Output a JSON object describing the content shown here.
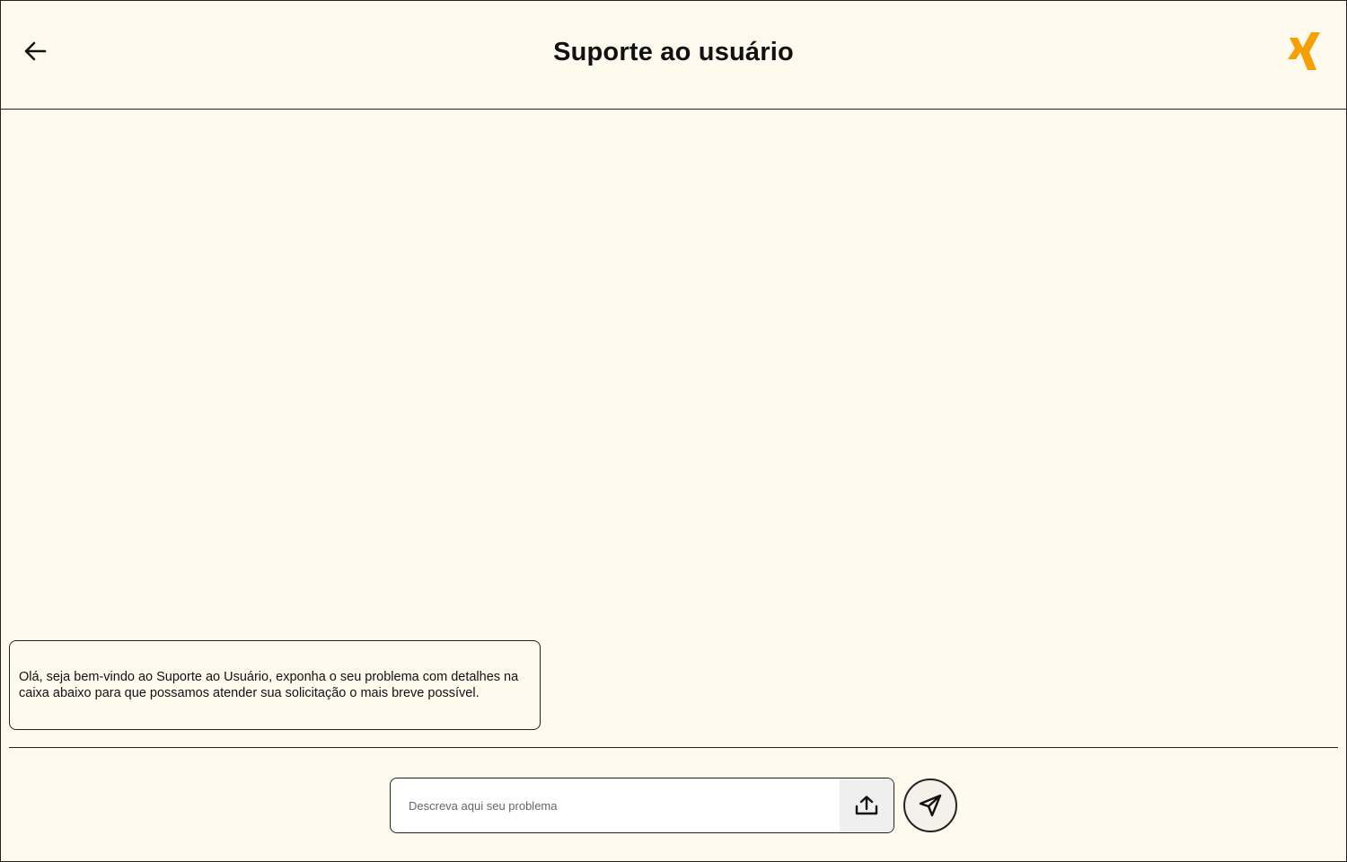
{
  "header": {
    "title": "Suporte ao usuário",
    "back_icon": "arrow-left-icon",
    "logo_icon": "xing-logo",
    "logo_color": "#f5a000"
  },
  "chat": {
    "messages": [
      {
        "text": "Olá, seja bem-vindo ao Suporte ao Usuário, exponha o seu problema com detalhes na caixa abaixo para que possamos atender sua solicitação o mais breve possível."
      }
    ]
  },
  "composer": {
    "placeholder": "Descreva aqui seu problema",
    "value": "",
    "upload_icon": "upload-icon",
    "send_icon": "send-icon"
  },
  "colors": {
    "background": "#fefaee",
    "border": "#222222",
    "accent": "#f5a000"
  }
}
